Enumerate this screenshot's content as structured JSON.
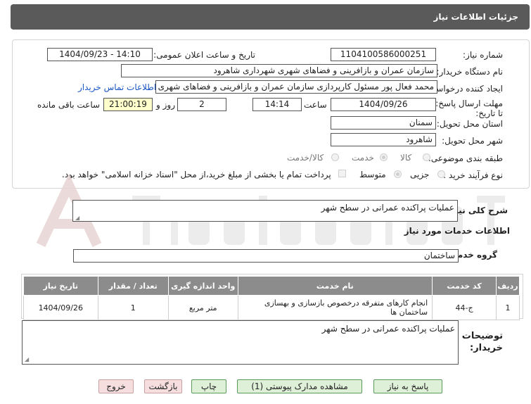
{
  "header": {
    "title": "جزئیات اطلاعات نیاز"
  },
  "form": {
    "need_number_label": "شماره نیاز:",
    "need_number": "1104100586000251",
    "announce_label": "تاریخ و ساعت اعلان عمومی:",
    "announce_value": "1404/09/23 - 14:10",
    "buyer_org_label": "نام دستگاه خریدار:",
    "buyer_org": "سازمان عمران و بازافرینی و فضاهای شهری شهرداری شاهرود",
    "requester_label": "ایجاد کننده درخواست:",
    "requester": "محمد فعال پور مسئول کارپردازی سازمان عمران و بازافرینی و فضاهای شهری شا",
    "contact_link": "اطلاعات تماس خریدار",
    "deadline_label": "مهلت ارسال پاسخ: تا تاریخ:",
    "deadline_date": "1404/09/26",
    "time_label": "ساعت",
    "deadline_time": "14:14",
    "days_value": "2",
    "days_label": "روز و",
    "remaining_time": "21:00:19",
    "remaining_label": "ساعت باقی مانده",
    "province_label": "استان محل تحویل:",
    "province": "سمنان",
    "city_label": "شهر محل تحویل:",
    "city": "شاهرود",
    "category_label": "طبقه بندی موضوعی:",
    "category_options": [
      "کالا",
      "خدمت",
      "کالا/خدمت"
    ],
    "category_selected": "خدمت",
    "process_label": "نوع فرآیند خرید :",
    "process_options": [
      "جزیی",
      "متوسط"
    ],
    "process_selected": "متوسط",
    "payment_note": "پرداخت تمام یا بخشی از مبلغ خرید،از محل \"اسناد خزانه اسلامی\" خواهد بود."
  },
  "summary": {
    "label": "شرح کلی نیاز:",
    "value": "عملیات پراکنده عمرانی در سطح شهر"
  },
  "services": {
    "section_title": "اطلاعات خدمات مورد نیاز",
    "group_label": "گروه خدمت:",
    "group_value": "ساختمان",
    "columns": [
      "ردیف",
      "کد خدمت",
      "نام خدمت",
      "واحد اندازه گیری",
      "تعداد / مقدار",
      "تاریخ نیاز"
    ],
    "rows": [
      {
        "index": "1",
        "code": "ج-44",
        "name": "انجام کارهای متفرقه درخصوص بازسازی و بهسازی ساختمان ها",
        "unit": "متر مربع",
        "qty": "1",
        "date": "1404/09/26"
      }
    ]
  },
  "buyer_notes": {
    "label_line1": "توضیحات",
    "label_line2": "خریدار:",
    "value": "عملیات پراکنده عمرانی در سطح شهر"
  },
  "buttons": {
    "reply": "پاسخ به نیاز",
    "attachments": "مشاهده مدارک پیوستی (1)",
    "print": "چاپ",
    "back": "بازگشت",
    "exit": "خروج"
  },
  "colors": {
    "title_bar": "#5a5a5a",
    "table_header": "#8c8c8c",
    "button_green": "#dff0d8",
    "button_red": "#f6dede",
    "link": "#1a56c4"
  }
}
